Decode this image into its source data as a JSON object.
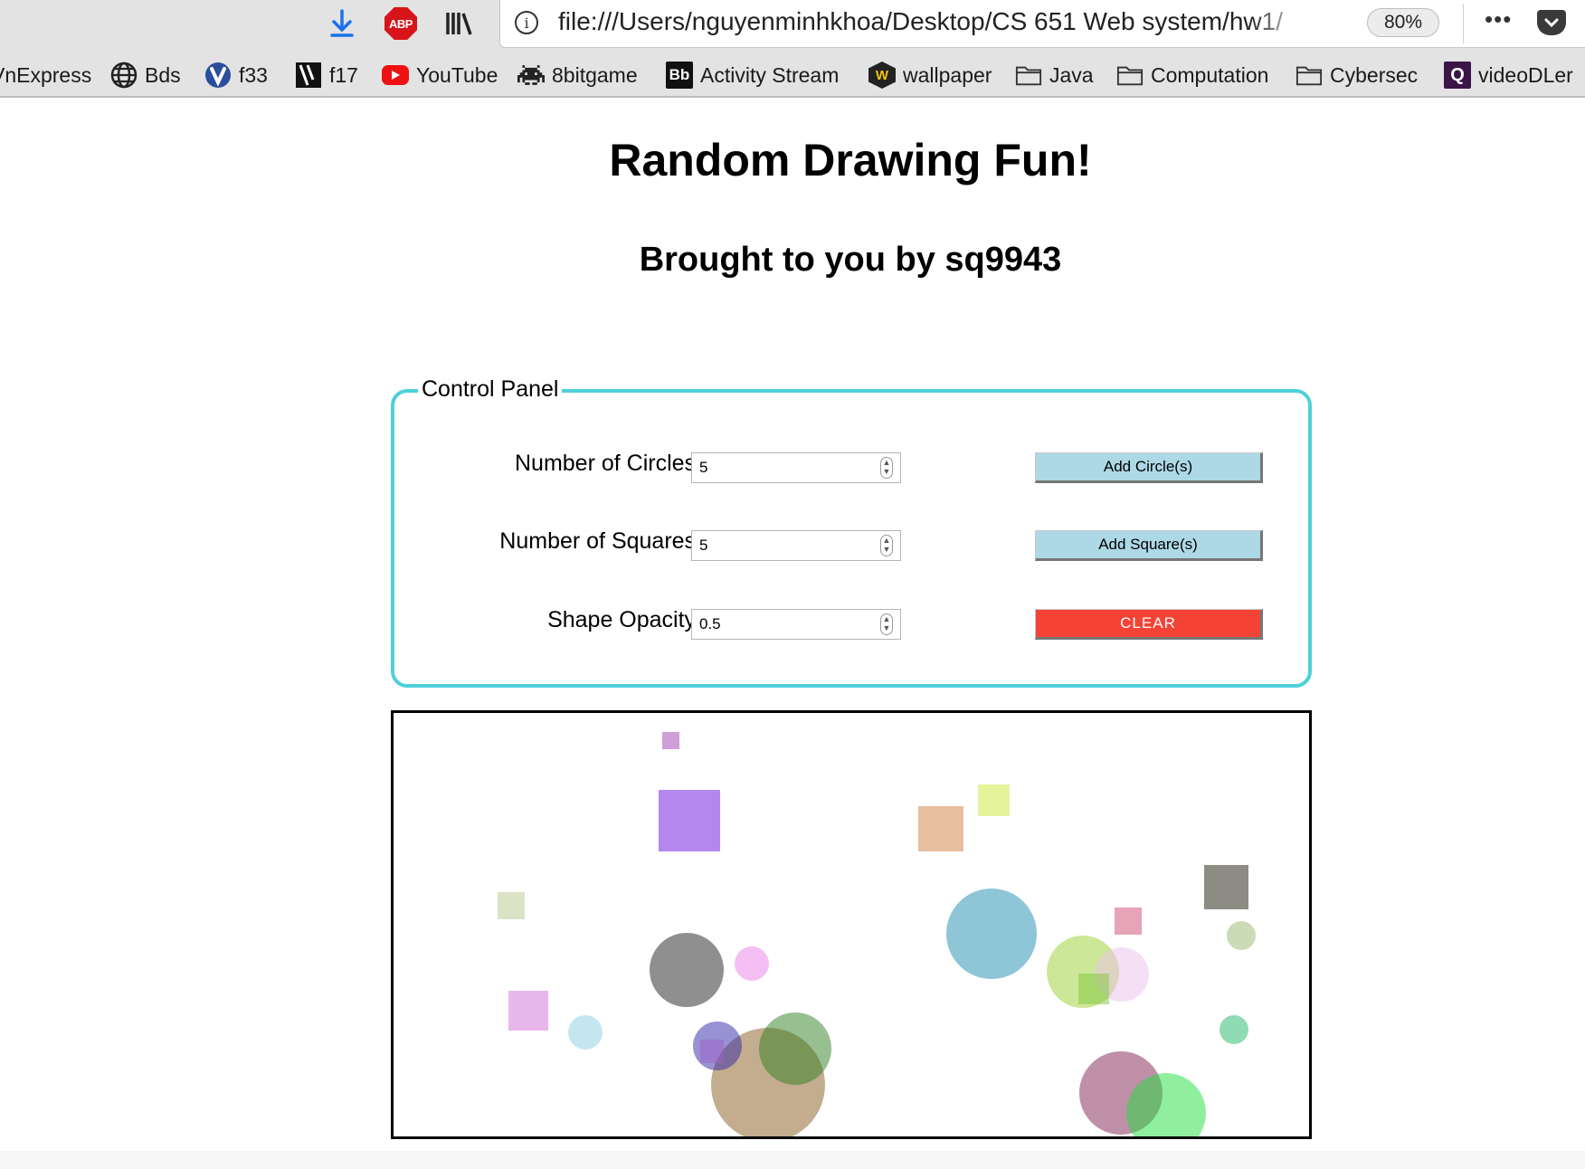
{
  "browser": {
    "url": "file:///Users/nguyenminhkhoa/Desktop/CS 651 Web system/hw1/",
    "zoom": "80%",
    "abp_label": "ABP",
    "more_label": "•••"
  },
  "bookmarks": [
    {
      "label": "VnExpress",
      "icon": "none"
    },
    {
      "label": "Bds",
      "icon": "globe-icon"
    },
    {
      "label": "f33",
      "icon": "vivaldi-icon"
    },
    {
      "label": "f17",
      "icon": "bookmark-logo-icon"
    },
    {
      "label": "YouTube",
      "icon": "youtube-icon"
    },
    {
      "label": "8bitgame",
      "icon": "space-invader-icon"
    },
    {
      "label": "Activity Stream",
      "icon": "blackboard-icon",
      "glyph": "Bb"
    },
    {
      "label": "wallpaper",
      "icon": "wallpaper-icon",
      "glyph": "W"
    },
    {
      "label": "Java",
      "icon": "folder-icon"
    },
    {
      "label": "Computation",
      "icon": "folder-icon"
    },
    {
      "label": "Cybersec",
      "icon": "folder-icon"
    },
    {
      "label": "videoDLer",
      "icon": "q-icon",
      "glyph": "Q"
    }
  ],
  "page": {
    "title": "Random Drawing Fun!",
    "subtitle": "Brought to you by sq9943"
  },
  "control_panel": {
    "legend": "Control Panel",
    "circles_label": "Number of Circles:",
    "circles_value": "5",
    "squares_label": "Number of Squares:",
    "squares_value": "5",
    "opacity_label": "Shape Opacity:",
    "opacity_value": "0.5",
    "add_circles_label": "Add Circle(s)",
    "add_squares_label": "Add Square(s)",
    "clear_label": "CLEAR"
  },
  "colors": {
    "panel_border": "#4fd0d8",
    "button_blue": "#add8e6",
    "button_red": "#f44336",
    "download_blue": "#1a73e8"
  },
  "drawing": {
    "shape_opacity": 0.5,
    "circles": [
      {
        "color": "#1f1f1f"
      },
      {
        "color": "#8ad0e0"
      },
      {
        "color": "#e880e8"
      },
      {
        "color": "#8a5a20"
      },
      {
        "color": "#308020"
      },
      {
        "color": "#1e8cb0"
      },
      {
        "color": "#9ad030"
      },
      {
        "color": "#ecc0ec"
      },
      {
        "color": "#98b870"
      },
      {
        "color": "#20b868"
      },
      {
        "color": "#802050"
      },
      {
        "color": "#20e040"
      },
      {
        "color": "#3028a8"
      }
    ],
    "squares": [
      {
        "color": "#a040b0"
      },
      {
        "color": "#6a10e0"
      },
      {
        "color": "#d08040"
      },
      {
        "color": "#ccea36"
      },
      {
        "color": "#1a1a0a"
      },
      {
        "color": "#b8c890"
      },
      {
        "color": "#d04870"
      },
      {
        "color": "#d070d8"
      },
      {
        "color": "#a060c8"
      },
      {
        "color": "#80c840"
      }
    ]
  }
}
